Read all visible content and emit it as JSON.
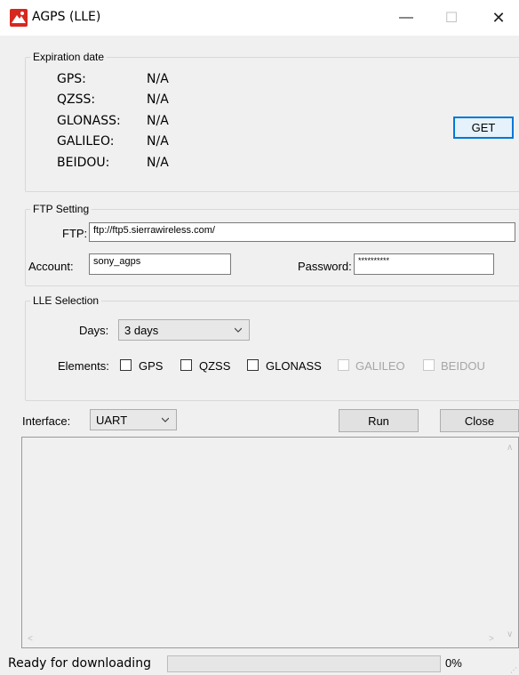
{
  "window": {
    "title": "AGPS (LLE)",
    "controls": {
      "minimize": "—",
      "maximize": "☐",
      "close": "✕"
    }
  },
  "expiration": {
    "title": "Expiration date",
    "rows": [
      {
        "label": "GPS:",
        "value": "N/A"
      },
      {
        "label": "QZSS:",
        "value": "N/A"
      },
      {
        "label": "GLONASS:",
        "value": "N/A"
      },
      {
        "label": "GALILEO:",
        "value": "N/A"
      },
      {
        "label": "BEIDOU:",
        "value": "N/A"
      }
    ],
    "get_label": "GET"
  },
  "ftp": {
    "title": "FTP Setting",
    "ftp_label": "FTP:",
    "ftp_value": "ftp://ftp5.sierrawireless.com/",
    "account_label": "Account:",
    "account_value": "sony_agps",
    "password_label": "Password:",
    "password_value": "**********"
  },
  "lle": {
    "title": "LLE Selection",
    "days_label": "Days:",
    "days_value": "3 days",
    "elements_label": "Elements:",
    "elements": [
      {
        "label": "GPS",
        "checked": false,
        "enabled": true
      },
      {
        "label": "QZSS",
        "checked": false,
        "enabled": true
      },
      {
        "label": "GLONASS",
        "checked": false,
        "enabled": true
      },
      {
        "label": "GALILEO",
        "checked": false,
        "enabled": false
      },
      {
        "label": "BEIDOU",
        "checked": false,
        "enabled": false
      }
    ]
  },
  "interface": {
    "label": "Interface:",
    "value": "UART"
  },
  "actions": {
    "run": "Run",
    "close": "Close"
  },
  "log": {
    "text": ""
  },
  "status": {
    "text": "Ready for downloading",
    "progress_percent": 0,
    "progress_text": "0%"
  },
  "colors": {
    "accent": "#0078d7",
    "progress_fill": "#06b025",
    "app_icon": "#d6281e"
  }
}
